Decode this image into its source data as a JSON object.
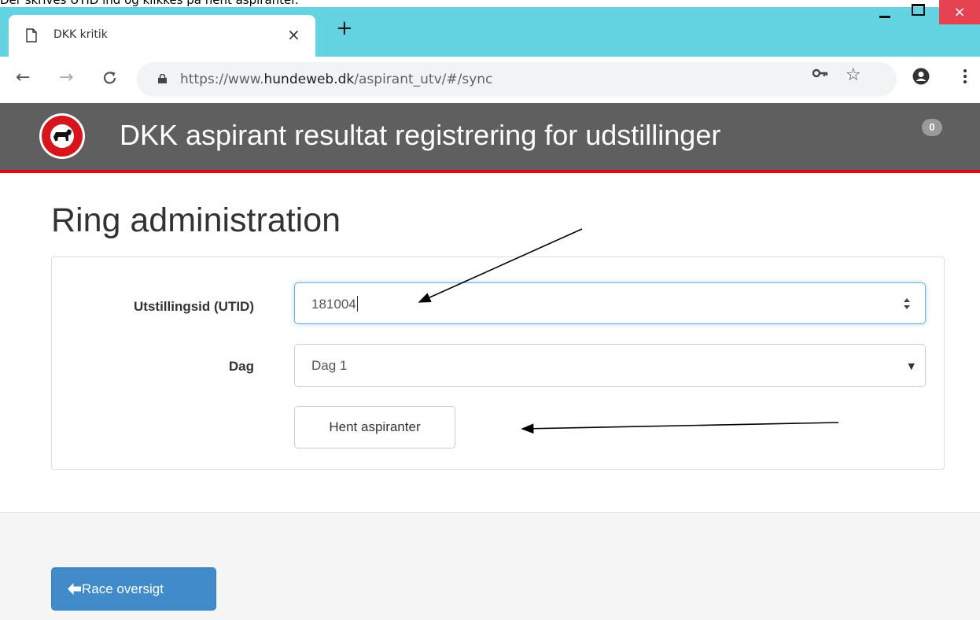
{
  "caption": "Der skrives UTID ind og klikkes på hent aspiranter.",
  "browser": {
    "tab_title": "DKK kritik",
    "tab_close": "×",
    "new_tab": "+",
    "window_close": "×",
    "url_host_prefix": "https://www.",
    "url_host": "hundeweb.dk",
    "url_path": "/aspirant_utv/#/sync",
    "back": "←",
    "forward": "→",
    "reload": "C",
    "star": "☆"
  },
  "app": {
    "title": "DKK aspirant resultat registrering for udstillinger",
    "badge_count": "0",
    "logo_icon": "dkk-logo"
  },
  "main": {
    "page_title": "Ring administration",
    "utid_label": "Utstillingsid (UTID)",
    "utid_value": "181004",
    "dag_label": "Dag",
    "dag_value": "Dag 1",
    "hent_button": "Hent aspiranter"
  },
  "footer": {
    "race_button": "Race oversigt"
  },
  "colors": {
    "tabstrip": "#63d3e2",
    "header": "#5f5f5f",
    "header_border": "#e20713",
    "primary_button": "#428bca"
  }
}
